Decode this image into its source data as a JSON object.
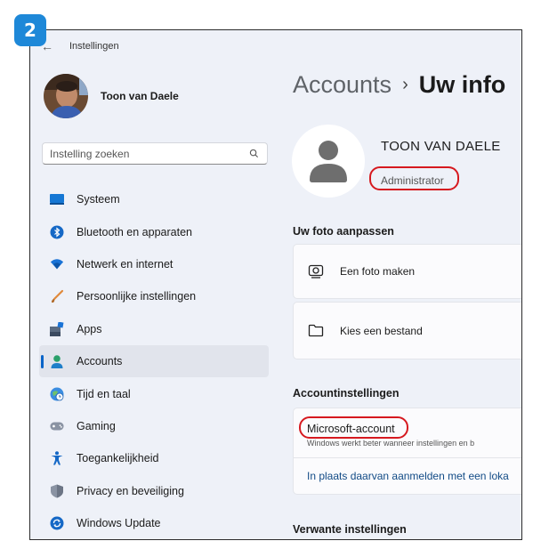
{
  "step_badge": "2",
  "window": {
    "title": "Instellingen"
  },
  "user": {
    "name": "Toon van Daele",
    "display_name": "TOON VAN DAELE",
    "role": "Administrator"
  },
  "search": {
    "placeholder": "Instelling zoeken"
  },
  "sidebar": {
    "items": [
      {
        "label": "Systeem",
        "icon": "monitor-icon"
      },
      {
        "label": "Bluetooth en apparaten",
        "icon": "bluetooth-icon"
      },
      {
        "label": "Netwerk en internet",
        "icon": "wifi-icon"
      },
      {
        "label": "Persoonlijke instellingen",
        "icon": "brush-icon"
      },
      {
        "label": "Apps",
        "icon": "apps-icon"
      },
      {
        "label": "Accounts",
        "icon": "person-icon",
        "active": true
      },
      {
        "label": "Tijd en taal",
        "icon": "globe-clock-icon"
      },
      {
        "label": "Gaming",
        "icon": "gamepad-icon"
      },
      {
        "label": "Toegankelijkheid",
        "icon": "accessibility-icon"
      },
      {
        "label": "Privacy en beveiliging",
        "icon": "shield-icon"
      },
      {
        "label": "Windows Update",
        "icon": "update-icon"
      }
    ]
  },
  "breadcrumb": {
    "parent": "Accounts",
    "separator": "›",
    "current": "Uw info"
  },
  "photo_section": {
    "title": "Uw foto aanpassen",
    "take_photo": "Een foto maken",
    "choose_file": "Kies een bestand"
  },
  "account_settings": {
    "title": "Accountinstellingen",
    "ms_account_title": "Microsoft-account",
    "ms_account_desc": "Windows werkt beter wanneer instellingen en b",
    "local_signin_link": "In plaats daarvan aanmelden met een loka"
  },
  "related_settings": {
    "title": "Verwante instellingen"
  },
  "colors": {
    "accent": "#0a64c8",
    "highlight_oval": "#d6191f",
    "badge": "#1e88d8"
  }
}
